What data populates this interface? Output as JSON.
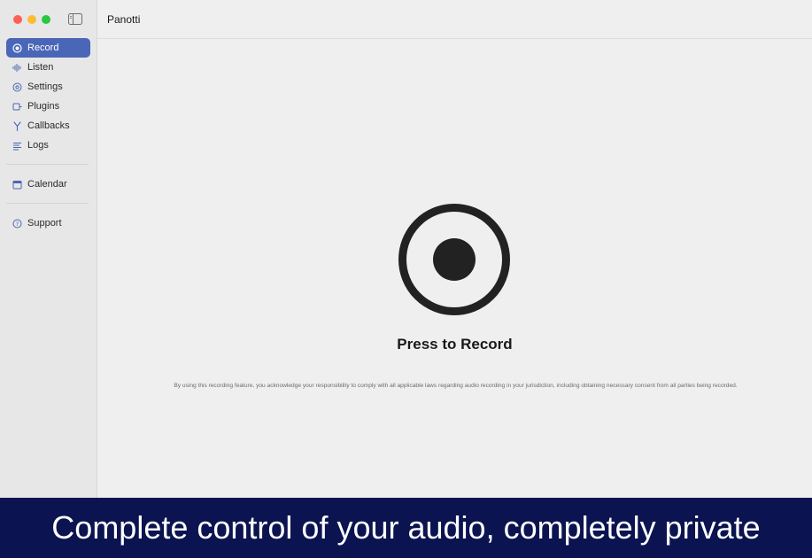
{
  "window": {
    "title": "Panotti"
  },
  "sidebar": {
    "items": [
      {
        "label": "Record",
        "icon": "record-icon"
      },
      {
        "label": "Listen",
        "icon": "waveform-icon"
      },
      {
        "label": "Settings",
        "icon": "settings-icon"
      },
      {
        "label": "Plugins",
        "icon": "plugin-icon"
      },
      {
        "label": "Callbacks",
        "icon": "fork-icon"
      },
      {
        "label": "Logs",
        "icon": "list-icon"
      }
    ],
    "secondary": [
      {
        "label": "Calendar",
        "icon": "calendar-icon"
      }
    ],
    "tertiary": [
      {
        "label": "Support",
        "icon": "help-icon"
      }
    ],
    "active": "Record"
  },
  "main": {
    "record_label": "Press to Record",
    "disclaimer": "By using this recording feature, you acknowledge your responsibility to comply with all applicable laws regarding audio recording in your jurisdiction, including obtaining necessary consent from all parties being recorded."
  },
  "caption": "Complete control of your audio, completely private",
  "colors": {
    "accent": "#4a66b6",
    "caption_background": "#0b1450"
  }
}
